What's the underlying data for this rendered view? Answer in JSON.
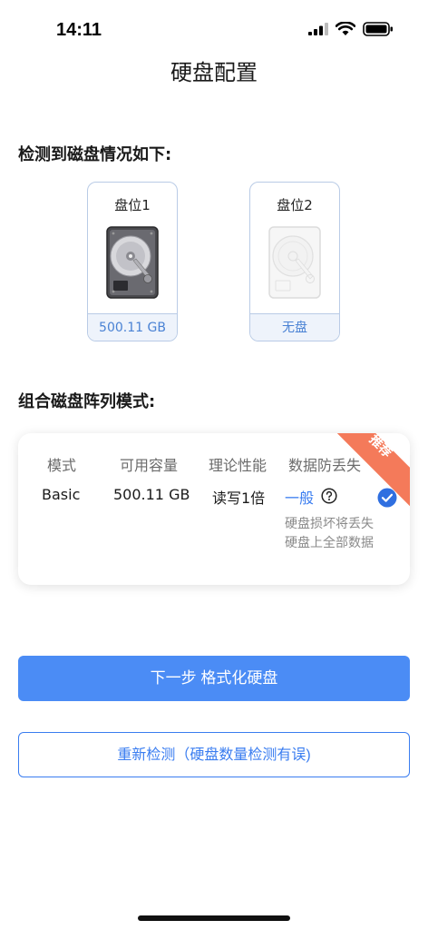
{
  "status_bar": {
    "time": "14:11",
    "icons": [
      "cellular-signal-icon",
      "wifi-icon",
      "battery-icon"
    ]
  },
  "nav": {
    "title": "硬盘配置"
  },
  "detection": {
    "title": "检测到磁盘情况如下:",
    "disks": [
      {
        "label": "盘位1",
        "status": "500.11 GB",
        "present": true
      },
      {
        "label": "盘位2",
        "status": "无盘",
        "present": false
      }
    ]
  },
  "raid": {
    "title": "组合磁盘阵列模式:",
    "columns": [
      "模式",
      "可用容量",
      "理论性能",
      "数据防丢失"
    ],
    "badge": "推荐",
    "option": {
      "mode": "Basic",
      "capacity": "500.11 GB",
      "performance": "读写1倍",
      "protection": "一般",
      "note": "硬盘损坏将丢失硬盘上全部数据",
      "selected": true
    }
  },
  "actions": {
    "next_label": "下一步 格式化硬盘",
    "redetect_label": "重新检测（硬盘数量检测有误)"
  },
  "colors": {
    "accent": "#4b8cf5",
    "link": "#3a7df0",
    "badge": "#f47a5a",
    "card_border": "#b9cbe6"
  }
}
